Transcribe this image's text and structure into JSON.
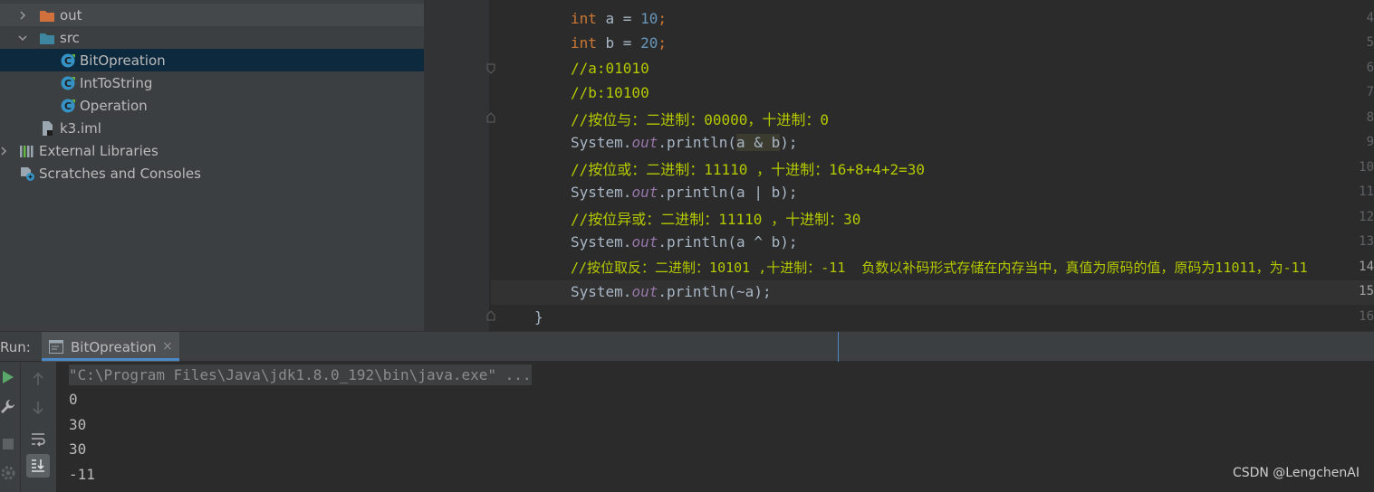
{
  "project_tree": {
    "items": [
      {
        "label": "out",
        "icon": "folder-orange-icon",
        "expanded": false
      },
      {
        "label": "src",
        "icon": "folder-blue-icon",
        "expanded": true
      },
      {
        "label": "BitOpreation",
        "icon": "java-class-icon",
        "selected": true
      },
      {
        "label": "IntToString",
        "icon": "java-class-icon"
      },
      {
        "label": "Operation",
        "icon": "java-class-icon"
      },
      {
        "label": "k3.iml",
        "icon": "iml-file-icon"
      },
      {
        "label": "External Libraries",
        "icon": "libraries-icon",
        "expanded": false
      },
      {
        "label": "Scratches and Consoles",
        "icon": "scratches-icon"
      }
    ]
  },
  "editor": {
    "current_line": "15",
    "line_numbers": [
      "4",
      "5",
      "6",
      "7",
      "8",
      "9",
      "10",
      "11",
      "12",
      "13",
      "14",
      "15",
      "16"
    ],
    "lines": [
      {
        "kw": "int",
        "rest": " a = ",
        "num": "10",
        "end": ";"
      },
      {
        "kw": "int",
        "rest": " b = ",
        "num": "20",
        "end": ";"
      },
      {
        "comment": "//a:01010"
      },
      {
        "comment": "//b:10100"
      },
      {
        "comment": "//按位与：二进制：00000，十进制：0"
      },
      {
        "pre": "System.",
        "field": "out",
        "mid": ".println(",
        "arg": "a & b",
        "post": ");"
      },
      {
        "comment": "//按位或：二进制：11110 ，十进制：16+8+4+2=30"
      },
      {
        "pre": "System.",
        "field": "out",
        "mid": ".println(",
        "arg": "a | b",
        "post": ");"
      },
      {
        "comment": "//按位异或：二进制：11110 ，十进制：30"
      },
      {
        "pre": "System.",
        "field": "out",
        "mid": ".println(",
        "arg": "a ^ b",
        "post": ");"
      },
      {
        "comment": "//按位取反：二进制：10101 ,十进制：-11  负数以补码形式存储在内存当中，真值为原码的值，原码为11011，为-11"
      },
      {
        "pre": "System.",
        "field": "out",
        "mid": ".println(",
        "arg": "~a",
        "post": ");"
      },
      {
        "brace": "}"
      }
    ]
  },
  "run_panel": {
    "label": "Run:",
    "tab_label": "BitOpreation",
    "tab_close": "×",
    "tab_icon": "console-tab-icon",
    "console_lines": [
      "\"C:\\Program Files\\Java\\jdk1.8.0_192\\bin\\java.exe\" ...",
      "0",
      "30",
      "30",
      "-11"
    ],
    "toolbar": [
      "run-icon",
      "wrench-icon",
      "stop-icon",
      "settings-icon",
      "up-arrow-icon",
      "down-arrow-icon",
      "soft-wrap-icon",
      "scroll-to-end-icon"
    ]
  },
  "watermark": "CSDN @LengchenAI",
  "colors": {
    "keyword": "#cc7832",
    "number": "#6897bb",
    "comment": "#b5c900",
    "field": "#9876aa",
    "selection": "#0d293e"
  }
}
